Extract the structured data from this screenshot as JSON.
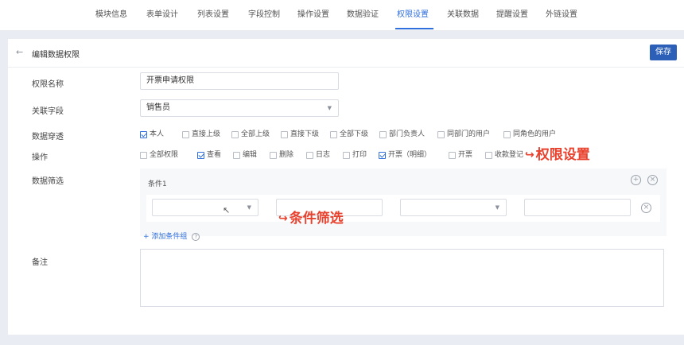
{
  "nav": {
    "tabs": [
      {
        "label": "模块信息"
      },
      {
        "label": "表单设计"
      },
      {
        "label": "列表设置"
      },
      {
        "label": "字段控制"
      },
      {
        "label": "操作设置"
      },
      {
        "label": "数据验证"
      },
      {
        "label": "权限设置"
      },
      {
        "label": "关联数据"
      },
      {
        "label": "提醒设置"
      },
      {
        "label": "外链设置"
      }
    ],
    "active_tab": "权限设置"
  },
  "header": {
    "back_icon": "←",
    "title": "编辑数据权限",
    "save_label": "保存"
  },
  "form": {
    "name": {
      "label": "权限名称",
      "value": "开票申请权限"
    },
    "field": {
      "label": "关联字段",
      "value": "销售员"
    },
    "penetration": {
      "label": "数据穿透",
      "options": [
        {
          "label": "本人",
          "checked": true
        },
        {
          "label": "直接上级",
          "checked": false
        },
        {
          "label": "全部上级",
          "checked": false
        },
        {
          "label": "直接下级",
          "checked": false
        },
        {
          "label": "全部下级",
          "checked": false
        },
        {
          "label": "部门负责人",
          "checked": false
        },
        {
          "label": "同部门的用户",
          "checked": false
        },
        {
          "label": "同角色的用户",
          "checked": false
        }
      ]
    },
    "operations": {
      "label": "操作",
      "options": [
        {
          "label": "全部权限",
          "checked": false
        },
        {
          "label": "查看",
          "checked": true
        },
        {
          "label": "编辑",
          "checked": false
        },
        {
          "label": "删除",
          "checked": false
        },
        {
          "label": "日志",
          "checked": false
        },
        {
          "label": "打印",
          "checked": false
        },
        {
          "label": "开票（明细）",
          "checked": true
        },
        {
          "label": "开票",
          "checked": false
        },
        {
          "label": "收款登记",
          "checked": false
        }
      ]
    },
    "filter": {
      "label": "数据筛选",
      "condition_title": "条件1",
      "add_group_label": "+ 添加条件组",
      "help_icon": "?"
    },
    "remark": {
      "label": "备注",
      "value": ""
    }
  },
  "annotations": {
    "permission": "权限设置",
    "filter": "条件筛选",
    "color": "#e8412d"
  },
  "colors": {
    "accent": "#2f6fde",
    "save_button": "#2b5fb8"
  }
}
